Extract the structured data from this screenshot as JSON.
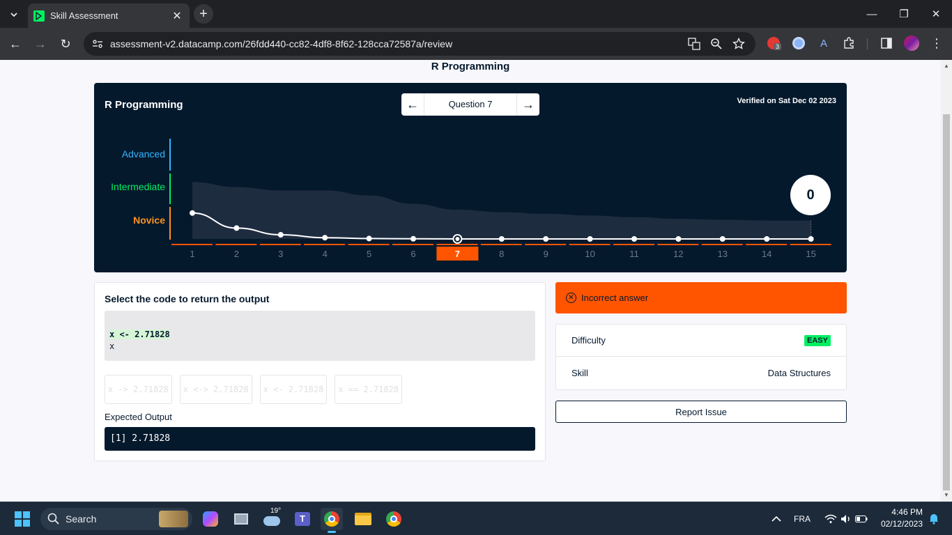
{
  "browser": {
    "tab_title": "Skill Assessment",
    "url": "assessment-v2.datacamp.com/26fdd440-cc82-4df8-8f62-128cca72587a/review",
    "extension_badge": "3"
  },
  "page": {
    "heading": "R Programming"
  },
  "chart": {
    "title": "R Programming",
    "question_label": "Question 7",
    "verified": "Verified on Sat Dec 02 2023",
    "levels": [
      {
        "label": "Advanced",
        "color": "#36b6ff"
      },
      {
        "label": "Intermediate",
        "color": "#03ef62"
      },
      {
        "label": "Novice",
        "color": "#ff931e"
      }
    ],
    "score": "0",
    "x_labels": [
      "1",
      "2",
      "3",
      "4",
      "5",
      "6",
      "7",
      "8",
      "9",
      "10",
      "11",
      "12",
      "13",
      "14",
      "15"
    ],
    "current_question": 7
  },
  "chart_data": {
    "type": "line",
    "x": [
      1,
      2,
      3,
      4,
      5,
      6,
      7,
      8,
      9,
      10,
      11,
      12,
      13,
      14,
      15
    ],
    "series": [
      {
        "values": [
          31,
          13,
          5,
          1.5,
          0.5,
          0.2,
          0,
          0,
          0,
          0,
          0,
          0,
          0,
          0,
          0
        ]
      }
    ],
    "band_upper": [
      68,
      62,
      58,
      58,
      52,
      42,
      35,
      32,
      30,
      28,
      26,
      24,
      23,
      22,
      22
    ]
  },
  "question": {
    "prompt": "Select the code to return the output",
    "code_line1": "x <- 2.71828",
    "code_line2": "x",
    "options": [
      "x -> 2.71828",
      "x <-> 2.71828",
      "x <- 2.71828",
      "x == 2.71828"
    ],
    "expected_label": "Expected Output",
    "expected_output": "[1] 2.71828"
  },
  "result": {
    "status": "Incorrect answer",
    "difficulty_label": "Difficulty",
    "difficulty_value": "EASY",
    "skill_label": "Skill",
    "skill_value": "Data Structures",
    "report_label": "Report Issue"
  },
  "taskbar": {
    "search_label": "Search",
    "weather_temp": "19°",
    "language": "FRA",
    "time": "4:46 PM",
    "date": "02/12/2023"
  },
  "colors": {
    "brand_green": "#03ef62",
    "navy": "#05192d",
    "orange": "#ff5400"
  }
}
